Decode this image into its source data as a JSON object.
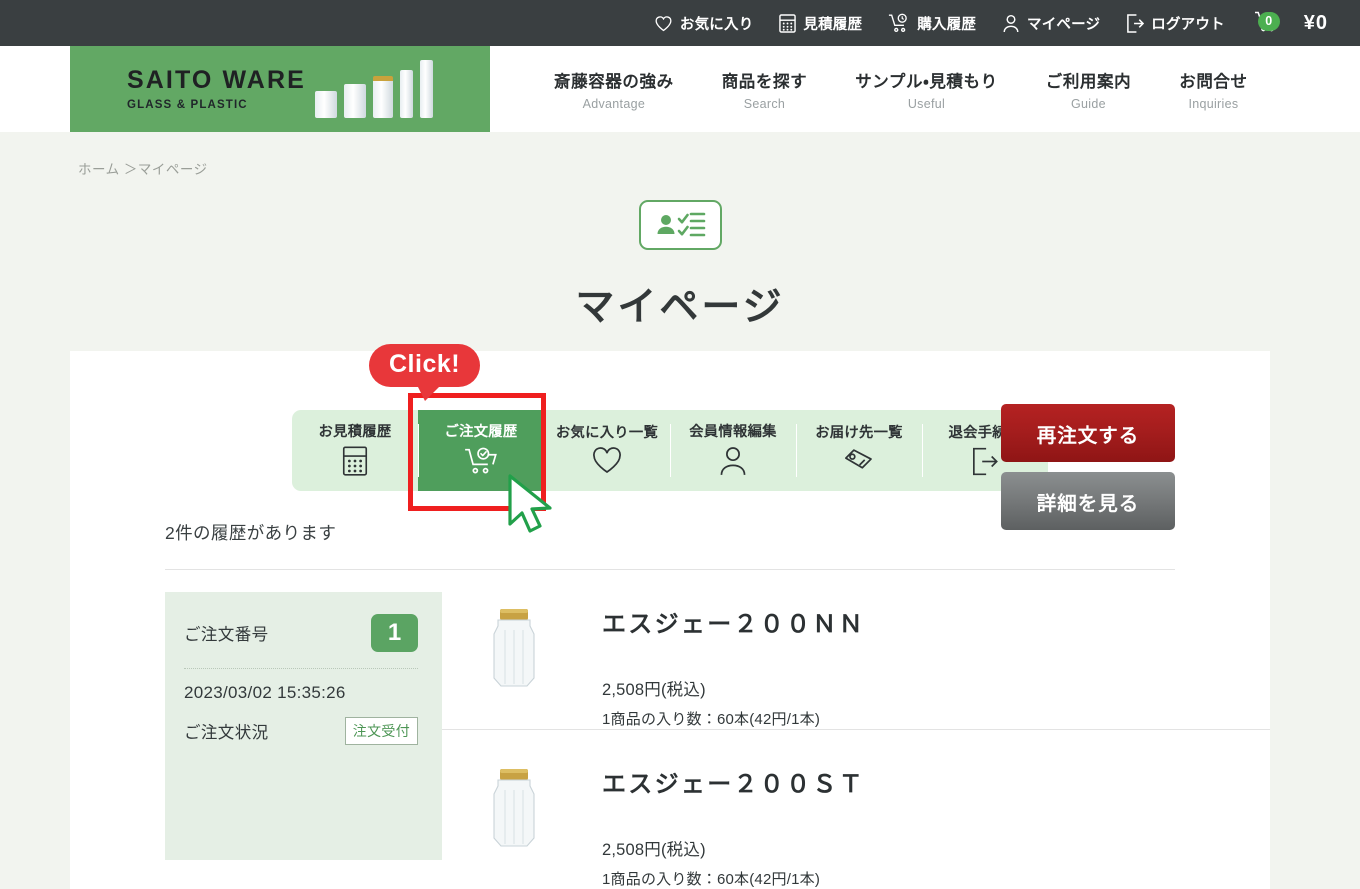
{
  "topbar": {
    "items": [
      {
        "label": "お気に入り",
        "icon": "heart-icon"
      },
      {
        "label": "見積履歴",
        "icon": "calculator-icon"
      },
      {
        "label": "購入履歴",
        "icon": "cart-clock-icon"
      },
      {
        "label": "マイページ",
        "icon": "person-icon"
      },
      {
        "label": "ログアウト",
        "icon": "logout-icon"
      }
    ],
    "cart_count": "0",
    "cart_total": "¥0",
    "badge_color": "#4caf50"
  },
  "header": {
    "logo_main": "SAITO WARE",
    "logo_sub": "GLASS & PLASTIC",
    "logo_bg": "#62a864",
    "nav": [
      {
        "ja": "斎藤容器の強み",
        "en": "Advantage"
      },
      {
        "ja": "商品を探す",
        "en": "Search"
      },
      {
        "ja": "サンプル・見積もり",
        "en": "Useful"
      },
      {
        "ja": "ご利用案内",
        "en": "Guide"
      },
      {
        "ja": "お問合せ",
        "en": "Inquiries"
      }
    ]
  },
  "breadcrumb": {
    "home": "ホーム",
    "separator": " ＞",
    "current": "マイページ"
  },
  "page": {
    "title": "マイページ",
    "title_icon": "id-card-checklist-icon"
  },
  "tabs": {
    "callout": "Click!",
    "highlight_color": "#ef1f1f",
    "active_index": 1,
    "items": [
      {
        "label": "お見積履歴",
        "icon": "calculator-icon"
      },
      {
        "label": "ご注文履歴",
        "icon": "cart-check-icon"
      },
      {
        "label": "お気に入り一覧",
        "icon": "heart-icon"
      },
      {
        "label": "会員情報編集",
        "icon": "person-icon"
      },
      {
        "label": "お届け先一覧",
        "icon": "tag-icon"
      },
      {
        "label": "退会手続き",
        "icon": "exit-icon"
      }
    ]
  },
  "history": {
    "count_text": "2件の履歴があります",
    "order": {
      "number_label": "ご注文番号",
      "number": "1",
      "date": "2023/03/02 15:35:26",
      "status_label": "ご注文状況",
      "status_value": "注文受付"
    },
    "items": [
      {
        "name": "エスジェー２００ＮＮ",
        "price": "2,508円(税込)",
        "quantity": "1商品の入り数：60本(42円/1本)",
        "thumb": "glass-jar-gold-lid"
      },
      {
        "name": "エスジェー２００ＳＴ",
        "price": "2,508円(税込)",
        "quantity": "1商品の入り数：60本(42円/1本)",
        "thumb": "glass-jar-gold-lid"
      }
    ],
    "buttons": {
      "reorder": "再注文する",
      "detail": "詳細を見る"
    }
  }
}
